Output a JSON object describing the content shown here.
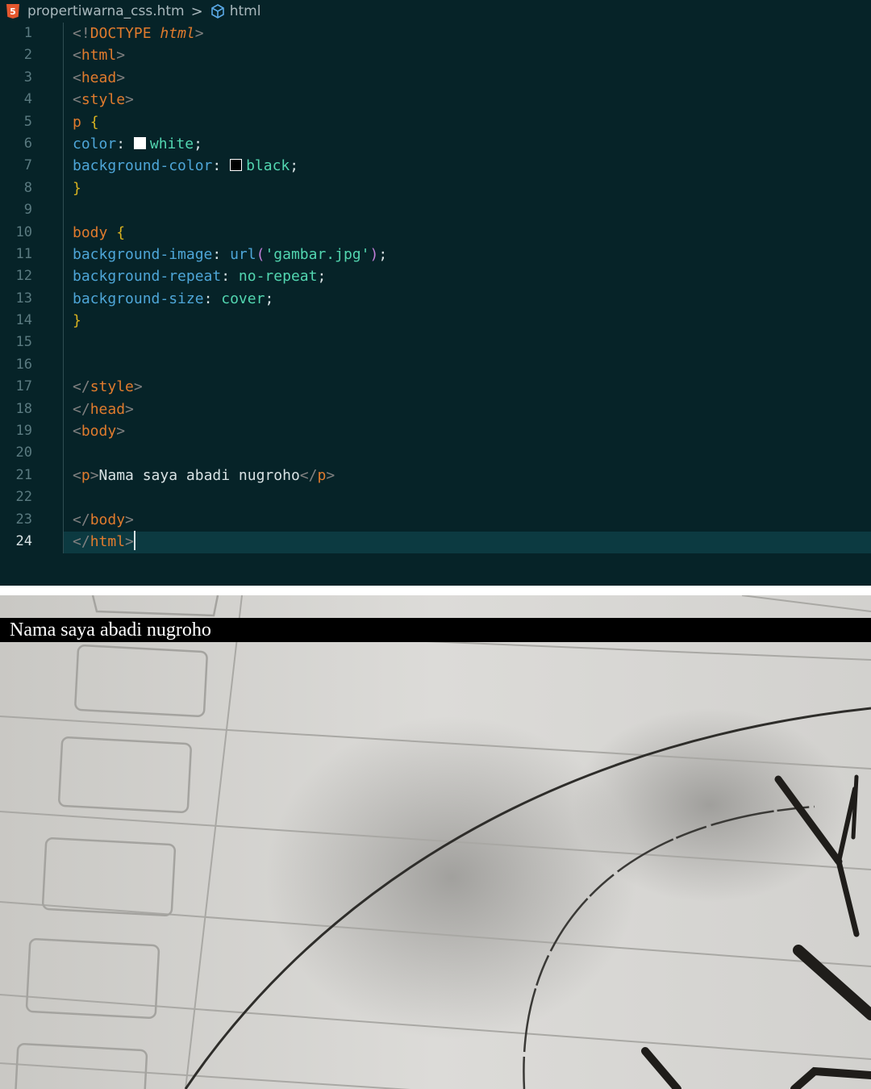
{
  "breadcrumb": {
    "file_icon": "html5-icon",
    "file_name": "propertiwarna_css.htm",
    "separator": ">",
    "symbol_icon": "cube-icon",
    "symbol": "html"
  },
  "editor": {
    "active_line": 24,
    "line_numbers": [
      "1",
      "2",
      "3",
      "4",
      "5",
      "6",
      "7",
      "8",
      "9",
      "10",
      "11",
      "12",
      "13",
      "14",
      "15",
      "16",
      "17",
      "18",
      "19",
      "20",
      "21",
      "22",
      "23",
      "24"
    ],
    "lines": [
      [
        {
          "t": "<!",
          "c": "punc"
        },
        {
          "t": "DOCTYPE ",
          "c": "tag"
        },
        {
          "t": "html",
          "c": "italic"
        },
        {
          "t": ">",
          "c": "punc"
        }
      ],
      [
        {
          "t": "<",
          "c": "punc"
        },
        {
          "t": "html",
          "c": "tag"
        },
        {
          "t": ">",
          "c": "punc"
        }
      ],
      [
        {
          "t": "<",
          "c": "punc"
        },
        {
          "t": "head",
          "c": "tag"
        },
        {
          "t": ">",
          "c": "punc"
        }
      ],
      [
        {
          "t": "<",
          "c": "punc"
        },
        {
          "t": "style",
          "c": "tag"
        },
        {
          "t": ">",
          "c": "punc"
        }
      ],
      [
        {
          "t": "p ",
          "c": "sel"
        },
        {
          "t": "{",
          "c": "brace"
        }
      ],
      [
        {
          "t": "color",
          "c": "prop"
        },
        {
          "t": ": ",
          "c": "colon"
        },
        {
          "t": "",
          "c": "swatch",
          "color": "#ffffff"
        },
        {
          "t": "white",
          "c": "val"
        },
        {
          "t": ";",
          "c": "colon"
        }
      ],
      [
        {
          "t": "background-color",
          "c": "prop"
        },
        {
          "t": ": ",
          "c": "colon"
        },
        {
          "t": "",
          "c": "swatch",
          "color": "#000000"
        },
        {
          "t": "black",
          "c": "val"
        },
        {
          "t": ";",
          "c": "colon"
        }
      ],
      [
        {
          "t": "}",
          "c": "brace"
        }
      ],
      [],
      [
        {
          "t": "body ",
          "c": "sel"
        },
        {
          "t": "{",
          "c": "brace"
        }
      ],
      [
        {
          "t": "background-image",
          "c": "prop"
        },
        {
          "t": ": ",
          "c": "colon"
        },
        {
          "t": "url",
          "c": "func"
        },
        {
          "t": "(",
          "c": "paren"
        },
        {
          "t": "'gambar.jpg'",
          "c": "str"
        },
        {
          "t": ")",
          "c": "paren"
        },
        {
          "t": ";",
          "c": "colon"
        }
      ],
      [
        {
          "t": "background-repeat",
          "c": "prop"
        },
        {
          "t": ": ",
          "c": "colon"
        },
        {
          "t": "no-repeat",
          "c": "val"
        },
        {
          "t": ";",
          "c": "colon"
        }
      ],
      [
        {
          "t": "background-size",
          "c": "prop"
        },
        {
          "t": ": ",
          "c": "colon"
        },
        {
          "t": "cover",
          "c": "val"
        },
        {
          "t": ";",
          "c": "colon"
        }
      ],
      [
        {
          "t": "}",
          "c": "brace"
        }
      ],
      [],
      [],
      [
        {
          "t": "</",
          "c": "punc"
        },
        {
          "t": "style",
          "c": "tag"
        },
        {
          "t": ">",
          "c": "punc"
        }
      ],
      [
        {
          "t": "</",
          "c": "punc"
        },
        {
          "t": "head",
          "c": "tag"
        },
        {
          "t": ">",
          "c": "punc"
        }
      ],
      [
        {
          "t": "<",
          "c": "punc"
        },
        {
          "t": "body",
          "c": "tag"
        },
        {
          "t": ">",
          "c": "punc"
        }
      ],
      [],
      [
        {
          "t": "<",
          "c": "punc"
        },
        {
          "t": "p",
          "c": "tag"
        },
        {
          "t": ">",
          "c": "punc"
        },
        {
          "t": "Nama saya abadi nugroho",
          "c": "text"
        },
        {
          "t": "</",
          "c": "punc"
        },
        {
          "t": "p",
          "c": "tag"
        },
        {
          "t": ">",
          "c": "punc"
        }
      ],
      [],
      [
        {
          "t": "</",
          "c": "punc"
        },
        {
          "t": "body",
          "c": "tag"
        },
        {
          "t": ">",
          "c": "punc"
        }
      ],
      [
        {
          "t": "</",
          "c": "punc"
        },
        {
          "t": "html",
          "c": "tag"
        },
        {
          "t": ">",
          "c": "punc"
        }
      ]
    ]
  },
  "preview": {
    "paragraph": "Nama saya abadi nugroho"
  }
}
